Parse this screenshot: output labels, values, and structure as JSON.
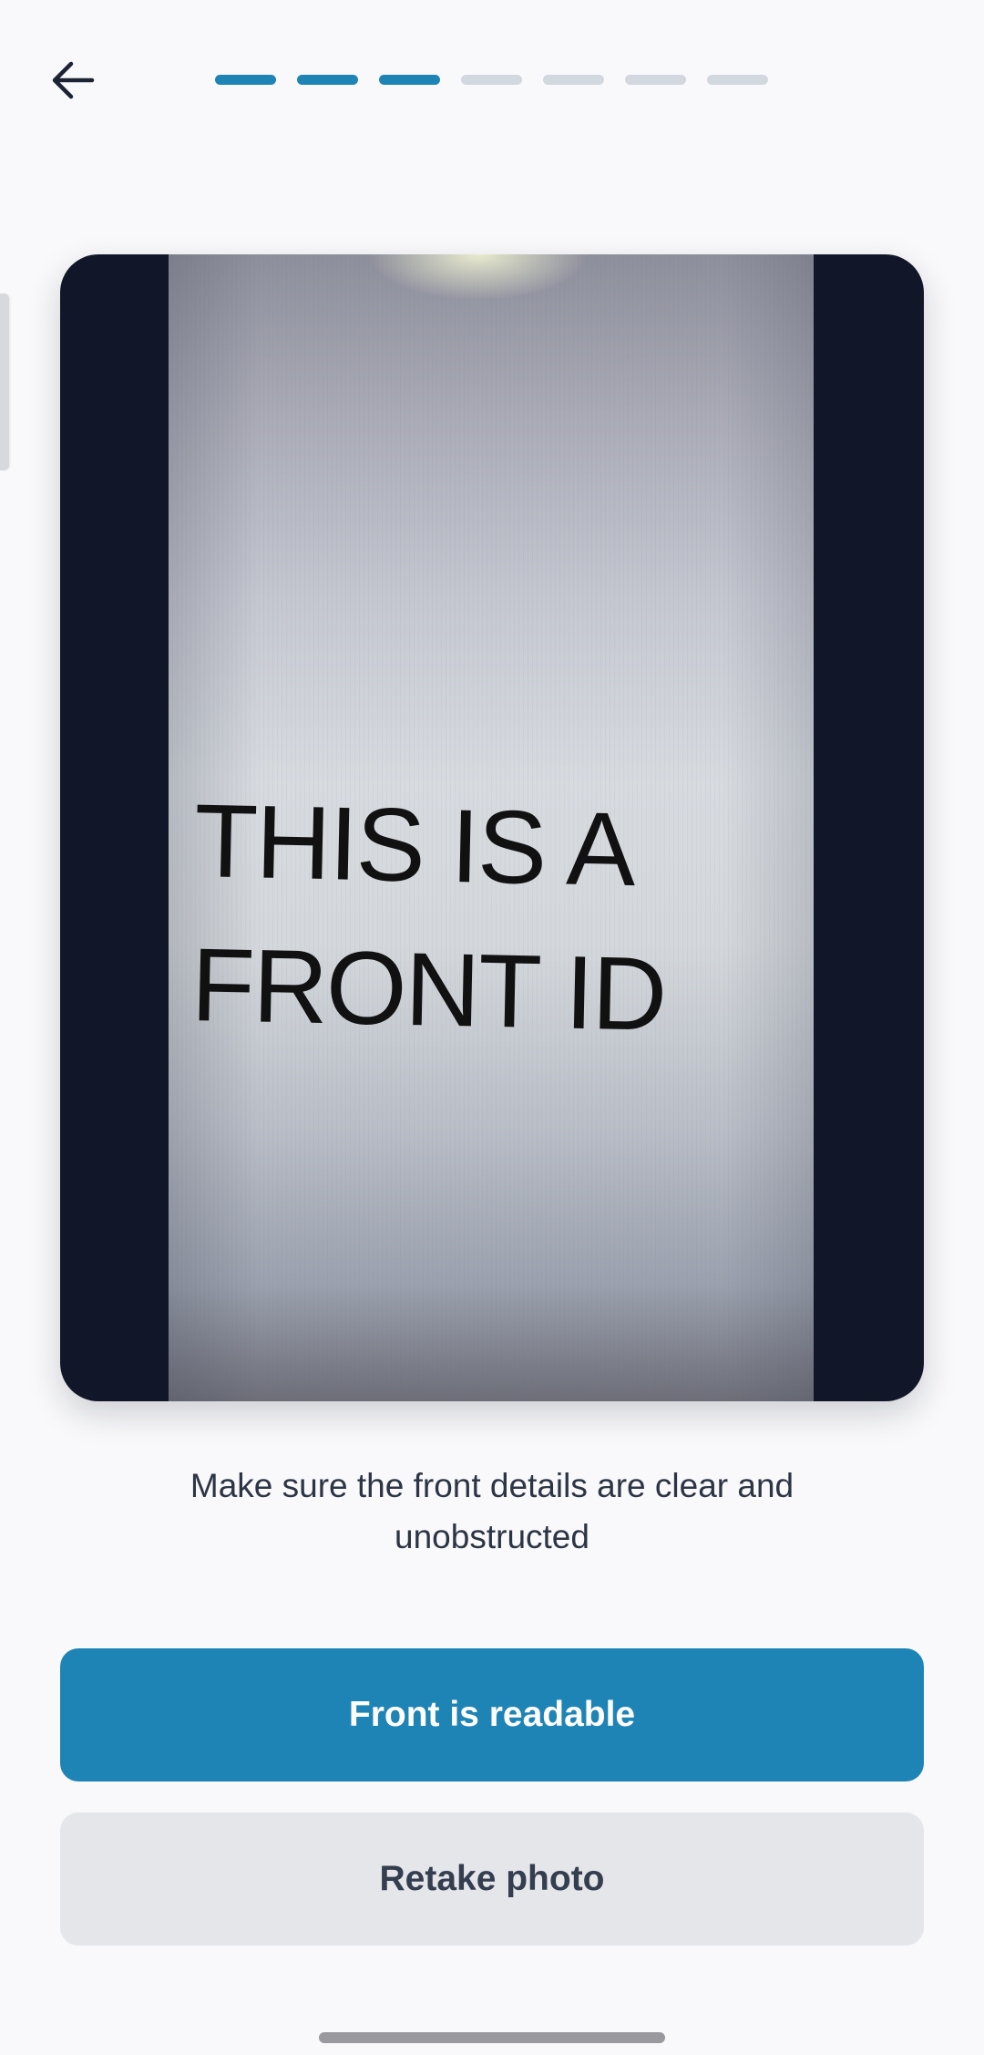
{
  "header": {
    "back_icon": "arrow-left-icon",
    "progress": {
      "total_steps": 7,
      "completed_steps": 3
    }
  },
  "photo": {
    "text_lines": [
      "THIS IS A",
      "FRONT ID"
    ]
  },
  "instruction": "Make sure the front details are clear and unobstructed",
  "actions": {
    "primary_label": "Front is readable",
    "secondary_label": "Retake photo"
  },
  "colors": {
    "accent": "#1e84b6",
    "progress_inactive": "#d2d8e0",
    "card_background": "#111729",
    "secondary_button": "#e5e6ea",
    "page_background": "#f9f9fb"
  }
}
